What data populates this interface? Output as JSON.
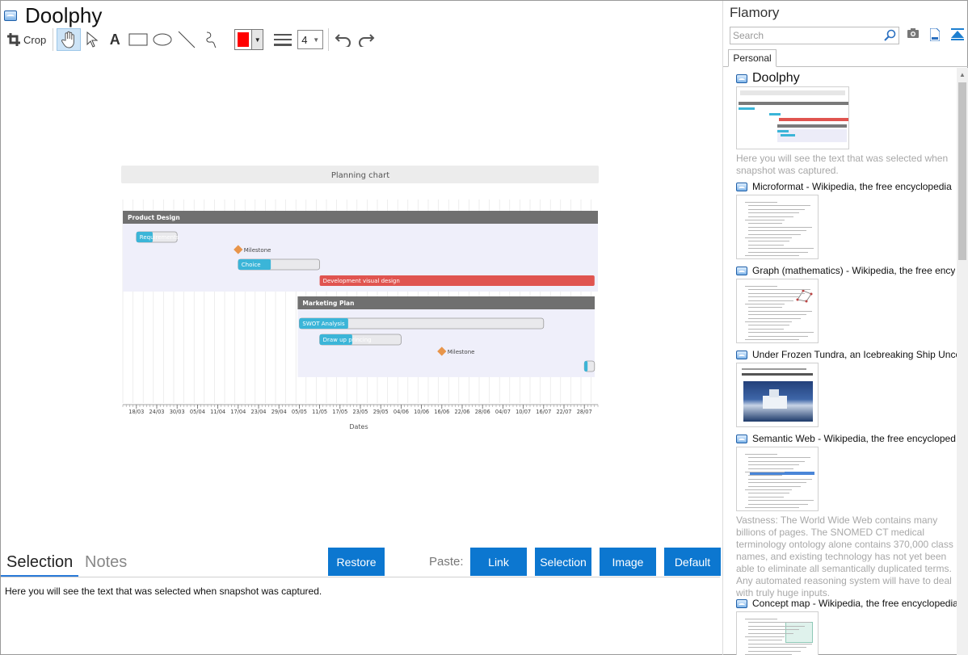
{
  "app": {
    "title": "Doolphy"
  },
  "toolbar": {
    "crop_label": "Crop",
    "tools": [
      "pan-tool",
      "select-tool",
      "text-tool",
      "rectangle-tool",
      "ellipse-tool",
      "line-tool",
      "freehand-tool"
    ],
    "color_value": "#ff0000",
    "line_width": "4"
  },
  "chart_data": {
    "type": "gantt",
    "title": "Planning chart",
    "xlabel": "Dates",
    "ticks": [
      "18/03",
      "24/03",
      "30/03",
      "05/04",
      "11/04",
      "17/04",
      "23/04",
      "29/04",
      "05/05",
      "11/05",
      "17/05",
      "23/05",
      "29/05",
      "04/06",
      "10/06",
      "16/06",
      "22/06",
      "28/06",
      "04/07",
      "10/07",
      "16/07",
      "22/07",
      "28/07"
    ],
    "groups": [
      {
        "name": "Product Design",
        "color": "#707070"
      },
      {
        "name": "Marketing Plan",
        "color": "#707070"
      }
    ],
    "tasks": [
      {
        "name": "Requirements",
        "group": "Product Design",
        "start": "18/03",
        "end": "30/03",
        "progress": 0.4,
        "color": "#3bb5d8"
      },
      {
        "name": "Milestone",
        "group": "Product Design",
        "type": "milestone",
        "date": "17/04",
        "color": "#e8954a"
      },
      {
        "name": "Choice",
        "group": "Product Design",
        "start": "17/04",
        "end": "11/05",
        "progress": 0.4,
        "color": "#3bb5d8"
      },
      {
        "name": "Development visual design",
        "group": "Product Design",
        "start": "11/05",
        "end": "31/07",
        "progress": 1.0,
        "color": "#e0544f"
      },
      {
        "name": "SWOT Analysis",
        "group": "Marketing Plan",
        "start": "05/05",
        "end": "16/07",
        "progress": 0.2,
        "color": "#3bb5d8"
      },
      {
        "name": "Draw up princing",
        "group": "Marketing Plan",
        "start": "11/05",
        "end": "04/06",
        "progress": 0.4,
        "color": "#3bb5d8"
      },
      {
        "name": "Milestone",
        "group": "Marketing Plan",
        "type": "milestone",
        "date": "16/06",
        "color": "#e8954a"
      },
      {
        "name": "",
        "group": "Marketing Plan",
        "start": "28/07",
        "end": "31/07",
        "progress": 0.2,
        "color": "#3bb5d8"
      }
    ]
  },
  "tabs": {
    "selection": "Selection",
    "notes": "Notes"
  },
  "actions": {
    "restore": "Restore",
    "paste_label": "Paste:",
    "link": "Link",
    "selection": "Selection",
    "image": "Image",
    "default": "Default"
  },
  "selection_text": "Here you will see the text that was selected when snapshot was captured.",
  "sidebar": {
    "title": "Flamory",
    "search_placeholder": "Search",
    "tab": "Personal",
    "items": [
      {
        "title": "Doolphy",
        "desc": "Here you will see the text that was selected when snapshot was captured."
      },
      {
        "title": "Microformat - Wikipedia, the free encyclopedia"
      },
      {
        "title": "Graph (mathematics) - Wikipedia, the free ency"
      },
      {
        "title": "Under Frozen Tundra, an Icebreaking Ship Unco"
      },
      {
        "title": "Semantic Web - Wikipedia, the free encycloped",
        "desc": "Vastness: The World Wide Web contains many billions of pages. The SNOMED CT medical terminology ontology alone contains 370,000 class names, and existing technology has not yet been able to eliminate all semantically duplicated terms. Any automated reasoning system will have to deal with truly huge inputs."
      },
      {
        "title": "Concept map - Wikipedia, the free encyclopedia"
      }
    ]
  }
}
